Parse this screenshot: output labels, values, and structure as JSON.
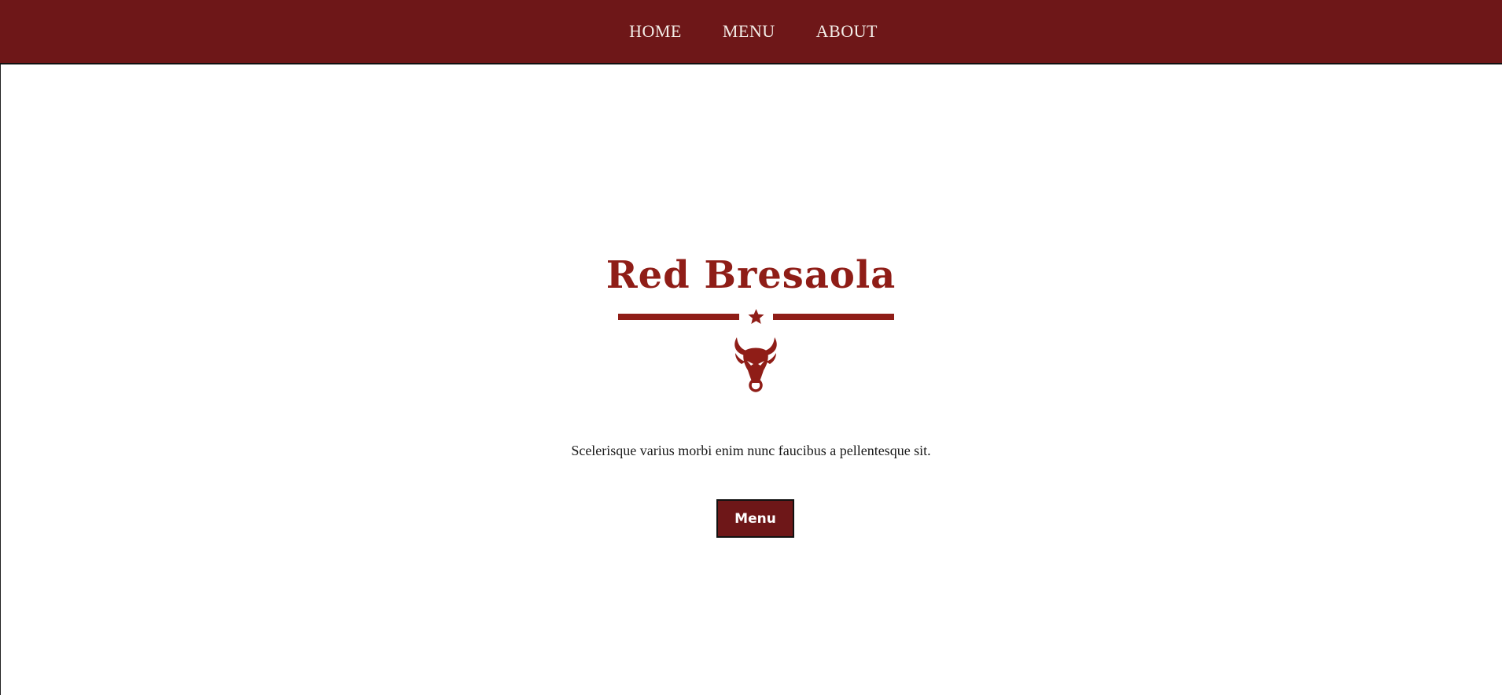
{
  "nav": {
    "items": [
      {
        "label": "HOME"
      },
      {
        "label": "MENU"
      },
      {
        "label": "ABOUT"
      }
    ]
  },
  "hero": {
    "title": "Red Bresaola",
    "tagline": "Scelerisque varius morbi enim nunc faucibus a pellentesque sit.",
    "button_label": "Menu"
  },
  "icons": {
    "divider": "star-divider-icon",
    "logo": "bull-head-icon"
  },
  "colors": {
    "topbar": "#6e1718",
    "accent": "#8f1d17",
    "button": "#6e1718",
    "nav_text": "#f4eee8"
  }
}
